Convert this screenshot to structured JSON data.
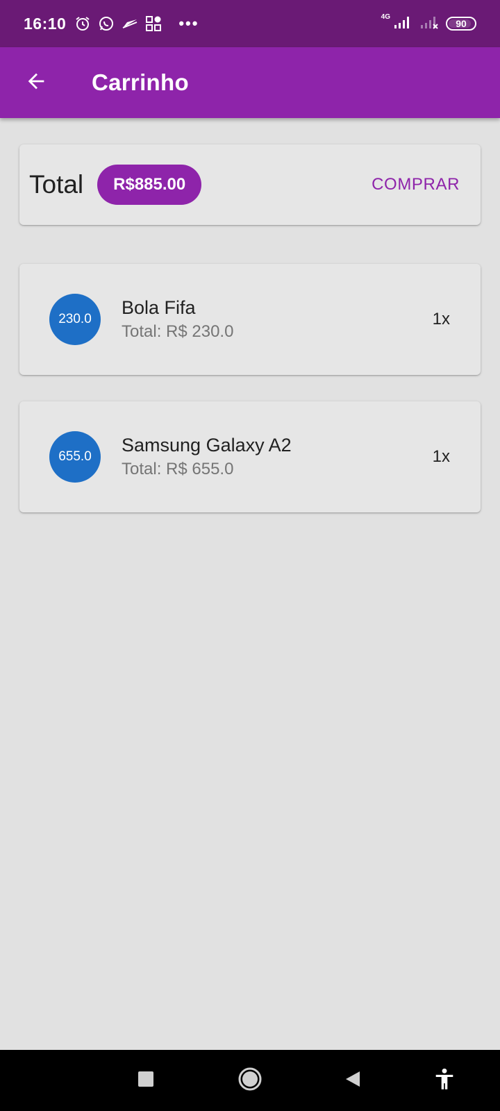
{
  "status_bar": {
    "time": "16:10",
    "network_label": "4G",
    "battery_level": "90",
    "icons": [
      "alarm-icon",
      "whatsapp-icon",
      "flag-icon",
      "apps-grid-icon",
      "more-dots-icon",
      "signal-icon",
      "signal-off-icon",
      "battery-icon"
    ],
    "more_dots": "•••"
  },
  "app_bar": {
    "title": "Carrinho",
    "back_icon": "arrow-back-icon"
  },
  "summary": {
    "total_label": "Total",
    "total_value": "R$885.00",
    "buy_label": "COMPRAR"
  },
  "items": [
    {
      "avatar_value": "230.0",
      "name": "Bola Fifa",
      "subtitle": "Total: R$ 230.0",
      "quantity": "1x"
    },
    {
      "avatar_value": "655.0",
      "name": "Samsung Galaxy A2",
      "subtitle": "Total: R$ 655.0",
      "quantity": "1x"
    }
  ],
  "nav_bar": {
    "icons": [
      "recents-square-icon",
      "home-circle-icon",
      "back-triangle-icon",
      "accessibility-icon"
    ]
  },
  "colors": {
    "status_bar": "#6a1a75",
    "primary": "#8e24aa",
    "avatar": "#1e6fc6",
    "background": "#e1e1e1",
    "card": "#e6e6e6"
  }
}
